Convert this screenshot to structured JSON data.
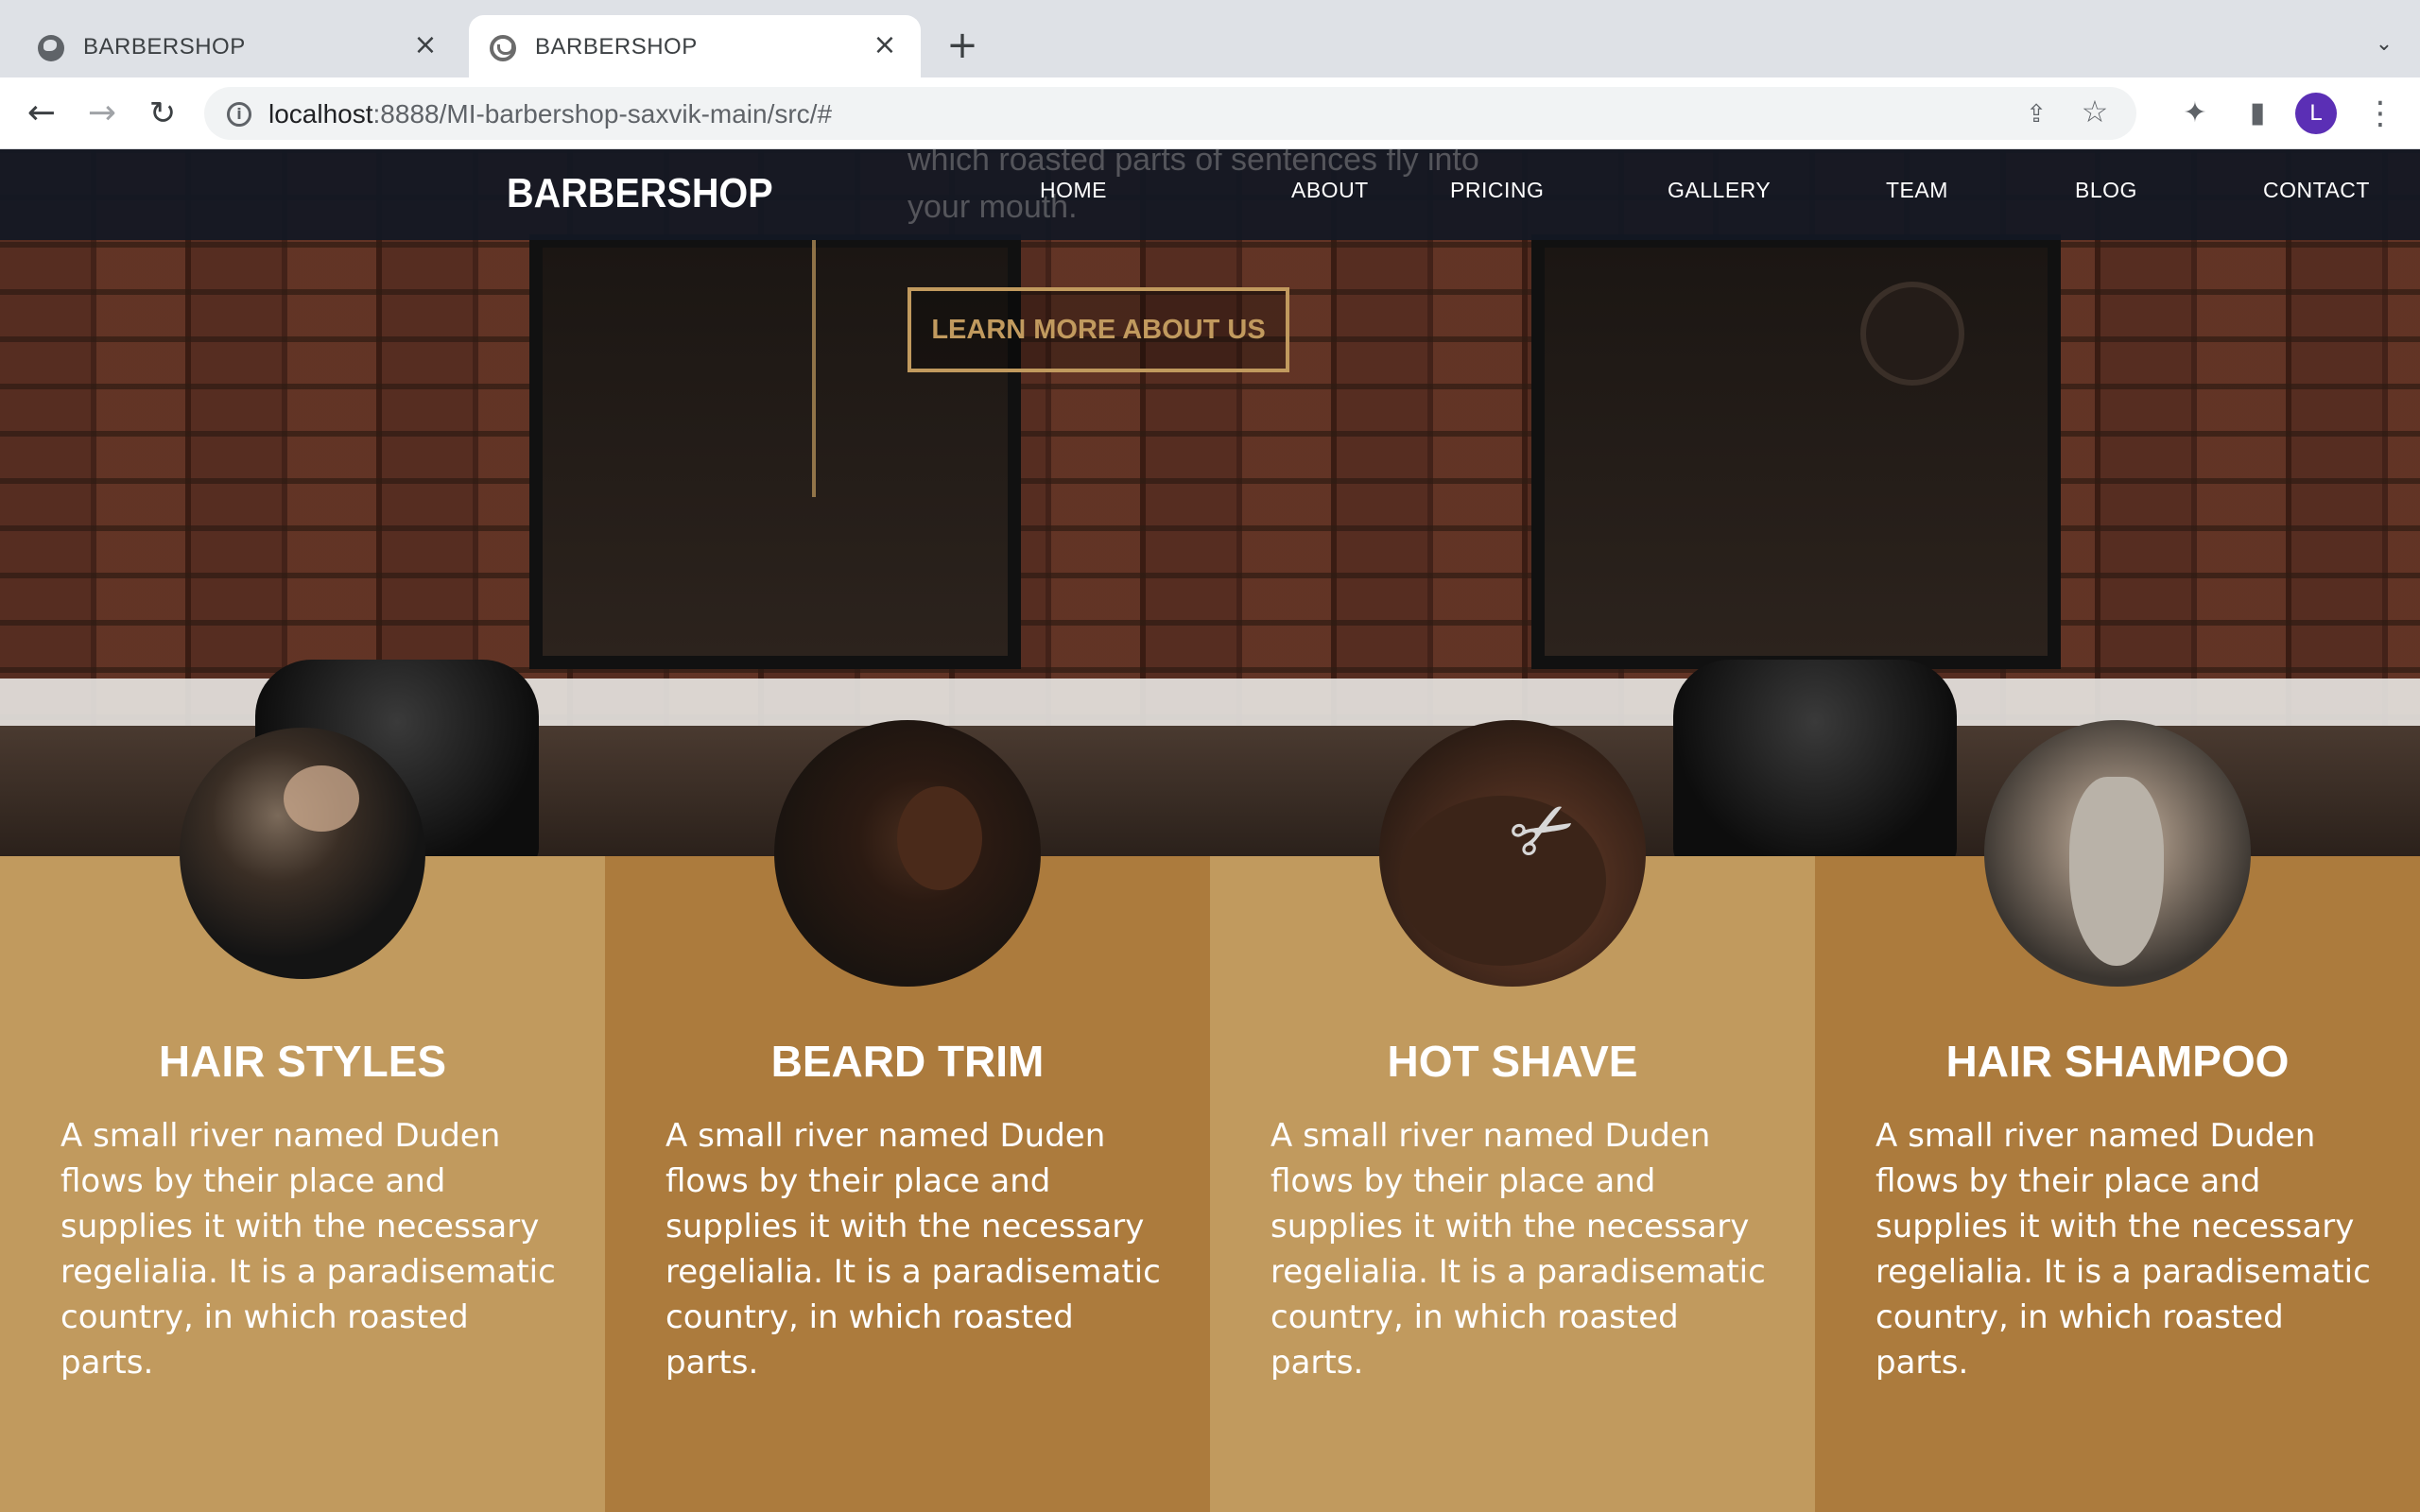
{
  "browser": {
    "tabs": [
      {
        "title": "BARBERSHOP",
        "favicon": "globe-icon",
        "active": false
      },
      {
        "title": "BARBERSHOP",
        "favicon": "barber-logo-icon",
        "active": true
      }
    ],
    "address": {
      "host": "localhost",
      "path": ":8888/MI-barbershop-saxvik-main/src/#"
    },
    "profile_initial": "L"
  },
  "site": {
    "brand": "BARBERSHOP",
    "nav": [
      "HOME",
      "ABOUT",
      "PRICING",
      "GALLERY",
      "TEAM",
      "BLOG",
      "CONTACT"
    ],
    "hero_text_fragment": "which roasted parts of sentences fly into your mouth.",
    "cta_label": "LEARN MORE ABOUT US"
  },
  "services": [
    {
      "title": "HAIR STYLES",
      "description": "A small river named Duden flows by their place and supplies it with the necessary regelialia. It is a paradisematic country, in which roasted parts.",
      "image": "hair-styles-photo"
    },
    {
      "title": "BEARD TRIM",
      "description": "A small river named Duden flows by their place and supplies it with the necessary regelialia. It is a paradisematic country, in which roasted parts.",
      "image": "beard-trim-photo"
    },
    {
      "title": "HOT SHAVE",
      "description": "A small river named Duden flows by their place and supplies it with the necessary regelialia. It is a paradisematic country, in which roasted parts.",
      "image": "hot-shave-photo"
    },
    {
      "title": "HAIR SHAMPOO",
      "description": "A small river named Duden flows by their place and supplies it with the necessary regelialia. It is a paradisematic country, in which roasted parts.",
      "image": "hair-shampoo-photo"
    }
  ],
  "colors": {
    "accent": "#c19a5e",
    "accent_dark": "#ac7b3d",
    "navbar": "#121823",
    "profile": "#5b2fb5"
  }
}
